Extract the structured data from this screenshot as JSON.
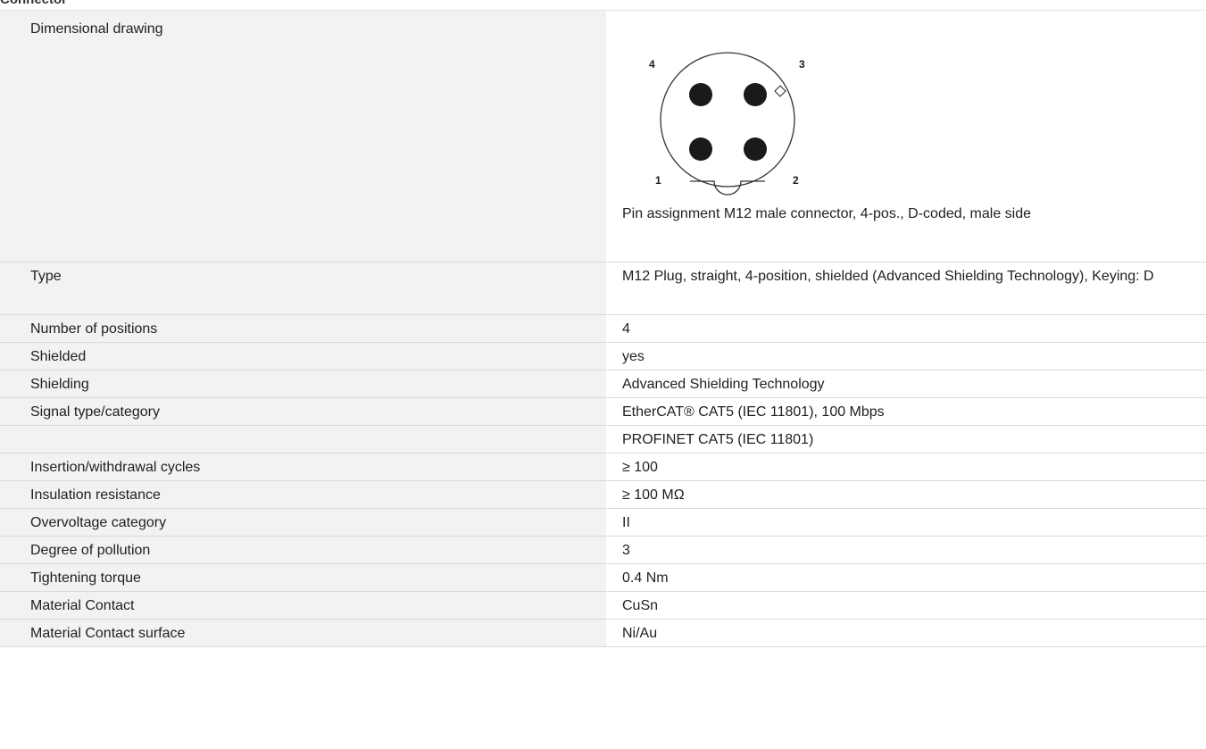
{
  "section_title": "Connector",
  "drawing": {
    "label": "Dimensional drawing",
    "pin_labels": [
      "4",
      "3",
      "1",
      "2"
    ],
    "caption": "Pin assignment M12 male connector, 4-pos., D-coded, male side"
  },
  "rows": [
    {
      "key": "Type",
      "value": "M12 Plug, straight, 4-position, shielded (Advanced Shielding Technology), Keying: D"
    },
    {
      "key": "Number of positions",
      "value": "4"
    },
    {
      "key": "Shielded",
      "value": "yes"
    },
    {
      "key": "Shielding",
      "value": "Advanced Shielding Technology"
    },
    {
      "key": "Signal type/category",
      "value": "EtherCAT® CAT5 (IEC 11801), 100 Mbps"
    },
    {
      "key": "",
      "value": "PROFINET CAT5 (IEC 11801)"
    },
    {
      "key": "Insertion/withdrawal cycles",
      "value": "≥ 100"
    },
    {
      "key": "Insulation resistance",
      "value": "≥ 100 MΩ"
    },
    {
      "key": "Overvoltage category",
      "value": "II"
    },
    {
      "key": "Degree of pollution",
      "value": "3"
    },
    {
      "key": "Tightening torque",
      "value": "0.4 Nm"
    },
    {
      "key": "Material Contact",
      "value": "CuSn"
    },
    {
      "key": "Material Contact surface",
      "value": "Ni/Au"
    }
  ]
}
